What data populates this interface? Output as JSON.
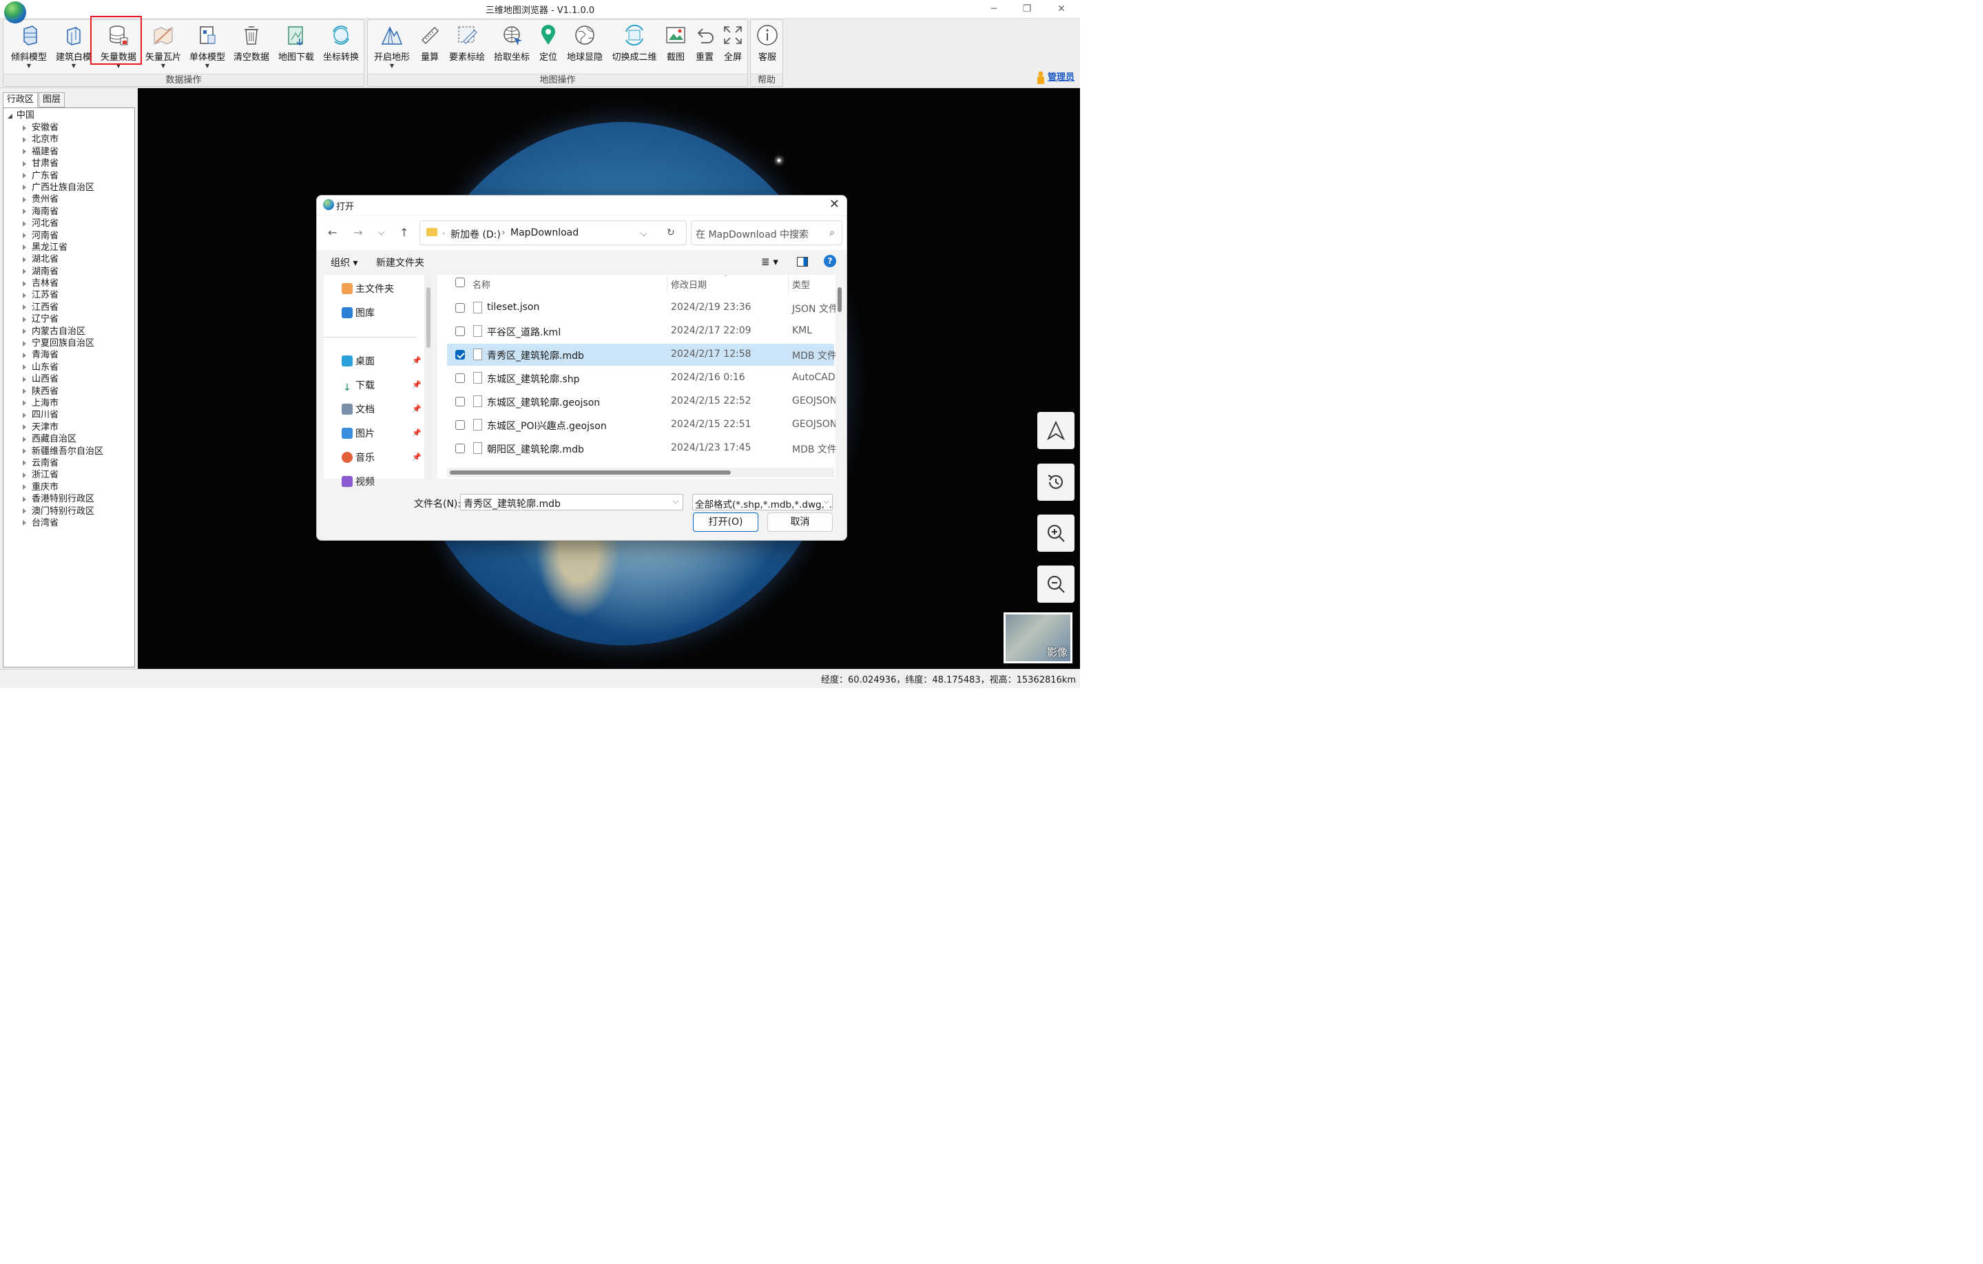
{
  "window": {
    "title": "三维地图浏览器 - V1.1.0.0",
    "minimize": "─",
    "maximize": "❐",
    "close": "✕"
  },
  "ribbon": {
    "data_group_label": "数据操作",
    "map_group_label": "地图操作",
    "help_group_label": "帮助",
    "buttons": {
      "tilted_model": "倾斜模型",
      "building_white": "建筑白模",
      "vector_data": "矢量数据",
      "vector_tile": "矢量瓦片",
      "single_model": "单体模型",
      "clear_data": "清空数据",
      "map_download": "地图下载",
      "coord_convert": "坐标转换",
      "open_terrain": "开启地形",
      "measure": "量算",
      "feature_plot": "要素标绘",
      "pick_coord": "拾取坐标",
      "locate": "定位",
      "globe_toggle": "地球显隐",
      "switch_2d": "切换成二维",
      "screenshot": "截图",
      "reset": "重置",
      "fullscreen": "全屏",
      "support": "客服"
    },
    "user": "管理员"
  },
  "left_panel": {
    "tabs": [
      "行政区",
      "图层"
    ],
    "root": "中国",
    "provinces": [
      "安徽省",
      "北京市",
      "福建省",
      "甘肃省",
      "广东省",
      "广西壮族自治区",
      "贵州省",
      "海南省",
      "河北省",
      "河南省",
      "黑龙江省",
      "湖北省",
      "湖南省",
      "吉林省",
      "江苏省",
      "江西省",
      "辽宁省",
      "内蒙古自治区",
      "宁夏回族自治区",
      "青海省",
      "山东省",
      "山西省",
      "陕西省",
      "上海市",
      "四川省",
      "天津市",
      "西藏自治区",
      "新疆维吾尔自治区",
      "云南省",
      "浙江省",
      "重庆市",
      "香港特别行政区",
      "澳门特别行政区",
      "台湾省"
    ]
  },
  "map": {
    "basemap_label": "影像"
  },
  "status": {
    "coords": "经度：60.024936，纬度：48.175483，视高：15362816km"
  },
  "dialog": {
    "title": "打开",
    "path": [
      "新加卷 (D:)",
      "MapDownload"
    ],
    "search_placeholder": "在 MapDownload 中搜索",
    "organize": "组织 ▾",
    "new_folder": "新建文件夹",
    "nav": {
      "home": "主文件夹",
      "gallery": "图库",
      "desktop": "桌面",
      "downloads": "下载",
      "documents": "文档",
      "pictures": "图片",
      "music": "音乐",
      "videos": "视频"
    },
    "columns": {
      "name": "名称",
      "modified": "修改日期",
      "type": "类型"
    },
    "files": [
      {
        "name": "tileset.json",
        "modified": "2024/2/19 23:36",
        "type": "JSON 文件",
        "selected": false
      },
      {
        "name": "平谷区_道路.kml",
        "modified": "2024/2/17 22:09",
        "type": "KML",
        "selected": false
      },
      {
        "name": "青秀区_建筑轮廓.mdb",
        "modified": "2024/2/17 12:58",
        "type": "MDB 文件",
        "selected": true
      },
      {
        "name": "东城区_建筑轮廓.shp",
        "modified": "2024/2/16 0:16",
        "type": "AutoCAD",
        "selected": false
      },
      {
        "name": "东城区_建筑轮廓.geojson",
        "modified": "2024/2/15 22:52",
        "type": "GEOJSON",
        "selected": false
      },
      {
        "name": "东城区_POI兴趣点.geojson",
        "modified": "2024/2/15 22:51",
        "type": "GEOJSON",
        "selected": false
      },
      {
        "name": "朝阳区_建筑轮廓.mdb",
        "modified": "2024/1/23 17:45",
        "type": "MDB 文件",
        "selected": false
      }
    ],
    "filename_label": "文件名(N):",
    "filename_value": "青秀区_建筑轮廓.mdb",
    "filter_value": "全部格式(*.shp,*.mdb,*.dwg,*.kml",
    "open_button": "打开(O)",
    "cancel_button": "取消"
  },
  "colors": {
    "accent": "#0067c0",
    "highlight_box": "#e51c23",
    "selected_row": "#cce4f7"
  }
}
